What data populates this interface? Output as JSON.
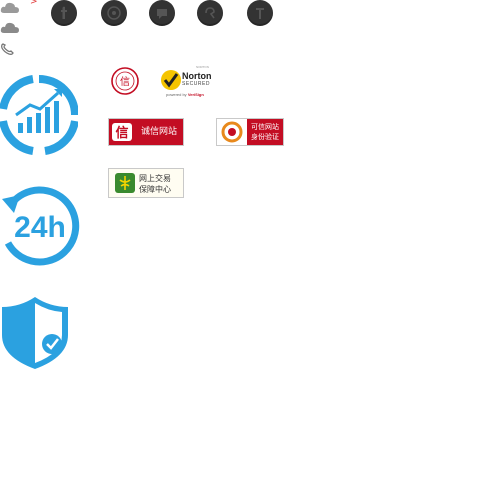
{
  "sprites": {
    "small_icons": [
      "cloud-icon",
      "cloud-icon",
      "phone-icon"
    ],
    "arrow": ">",
    "social_circles": [
      "social-icon-1",
      "social-icon-2",
      "social-icon-3",
      "social-icon-4",
      "social-icon-5"
    ],
    "accent_color": "#2ba1e0",
    "social_color": "#333333"
  },
  "features": {
    "growth_icon": "growth-chart-icon",
    "service_label": "24h",
    "shield_icon": "shield-check-icon"
  },
  "badges": {
    "seal": {
      "icon": "trust-seal-icon",
      "char": "信"
    },
    "norton": {
      "top_text": "NORTON",
      "brand": "Norton",
      "secured": "SECURED",
      "powered": "powered by",
      "verisign": "VeriSign"
    },
    "xinyong": {
      "logo_char": "信",
      "label": "诚信网站"
    },
    "kexin": {
      "label_line1": "可信网站",
      "label_line2": "身份验证"
    },
    "wangshang": {
      "label_line1": "网上交易",
      "label_line2": "保障中心"
    },
    "brand_red": "#c30d23"
  }
}
